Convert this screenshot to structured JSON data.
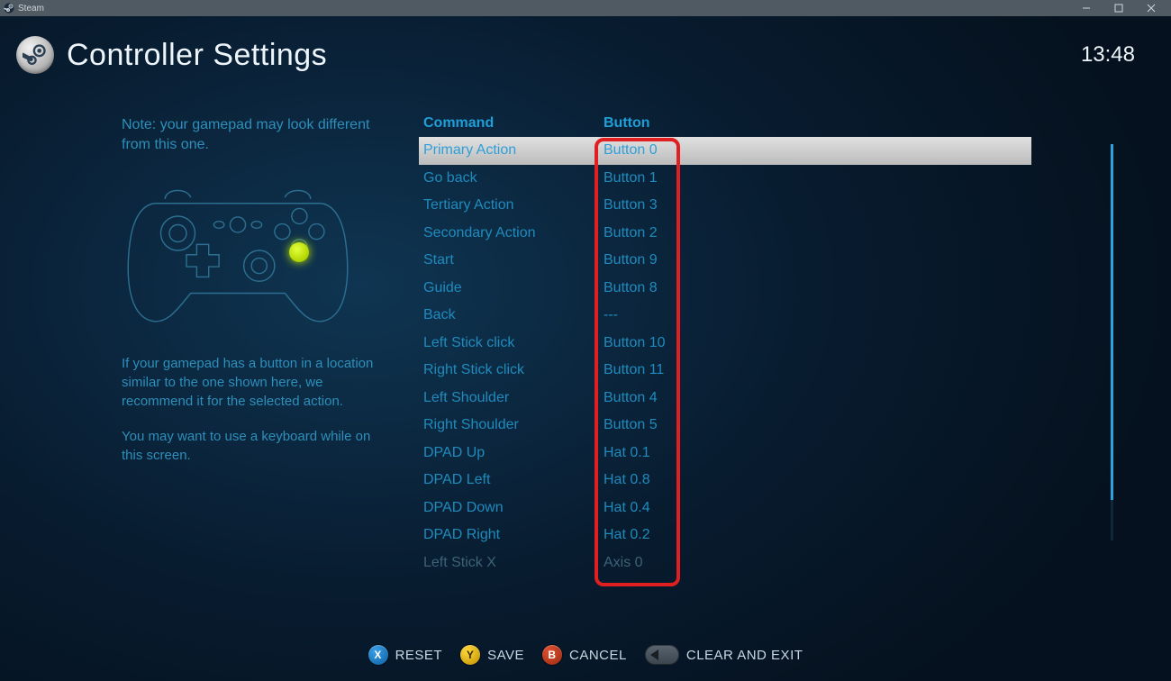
{
  "window": {
    "title": "Steam"
  },
  "header": {
    "title": "Controller Settings",
    "clock": "13:48"
  },
  "left": {
    "note": "Note: your gamepad may look different from this one.",
    "hint1": "If your gamepad has a button in a location similar to the one shown here, we recommend it for the selected action.",
    "hint2": "You may want to use a keyboard while on this screen."
  },
  "table": {
    "col_command": "Command",
    "col_button": "Button",
    "rows": [
      {
        "cmd": "Primary Action",
        "btn": "Button 0",
        "selected": true
      },
      {
        "cmd": "Go back",
        "btn": "Button 1"
      },
      {
        "cmd": "Tertiary Action",
        "btn": "Button 3"
      },
      {
        "cmd": "Secondary Action",
        "btn": "Button 2"
      },
      {
        "cmd": "Start",
        "btn": "Button 9"
      },
      {
        "cmd": "Guide",
        "btn": "Button 8"
      },
      {
        "cmd": "Back",
        "btn": "---"
      },
      {
        "cmd": "Left Stick click",
        "btn": "Button 10"
      },
      {
        "cmd": "Right Stick click",
        "btn": "Button 11"
      },
      {
        "cmd": "Left Shoulder",
        "btn": "Button 4"
      },
      {
        "cmd": "Right Shoulder",
        "btn": "Button 5"
      },
      {
        "cmd": "DPAD Up",
        "btn": "Hat 0.1"
      },
      {
        "cmd": "DPAD Left",
        "btn": "Hat 0.8"
      },
      {
        "cmd": "DPAD Down",
        "btn": "Hat 0.4"
      },
      {
        "cmd": "DPAD Right",
        "btn": "Hat 0.2"
      },
      {
        "cmd": "Left Stick X",
        "btn": "Axis 0",
        "faded": true
      }
    ]
  },
  "footer": {
    "reset": "RESET",
    "save": "SAVE",
    "cancel": "CANCEL",
    "clear_exit": "CLEAR AND EXIT"
  }
}
